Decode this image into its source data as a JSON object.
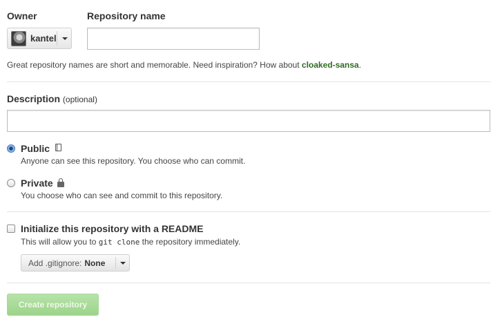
{
  "owner": {
    "label": "Owner",
    "selected": "kantel",
    "avatar_icon": "user-avatar"
  },
  "repo_name": {
    "label": "Repository name",
    "value": "",
    "placeholder": ""
  },
  "hint": {
    "text": "Great repository names are short and memorable. Need inspiration? How about ",
    "suggestion": "cloaked-sansa",
    "suffix": ".",
    "suggestion_color": "#2f6b22"
  },
  "description": {
    "label": "Description",
    "optional": "(optional)",
    "value": "",
    "placeholder": ""
  },
  "visibility": {
    "selected": "public",
    "public": {
      "title": "Public",
      "desc": "Anyone can see this repository. You choose who can commit.",
      "icon": "book-icon"
    },
    "private": {
      "title": "Private",
      "desc": "You choose who can see and commit to this repository.",
      "icon": "lock-icon"
    }
  },
  "readme": {
    "title": "Initialize this repository with a README",
    "desc_before": "This will allow you to ",
    "desc_code": "git clone",
    "desc_after": " the repository immediately.",
    "checked": false
  },
  "gitignore": {
    "label": "Add .gitignore:",
    "value": "None"
  },
  "create_button": {
    "label": "Create repository",
    "disabled": true,
    "color": "#9cd38b"
  }
}
